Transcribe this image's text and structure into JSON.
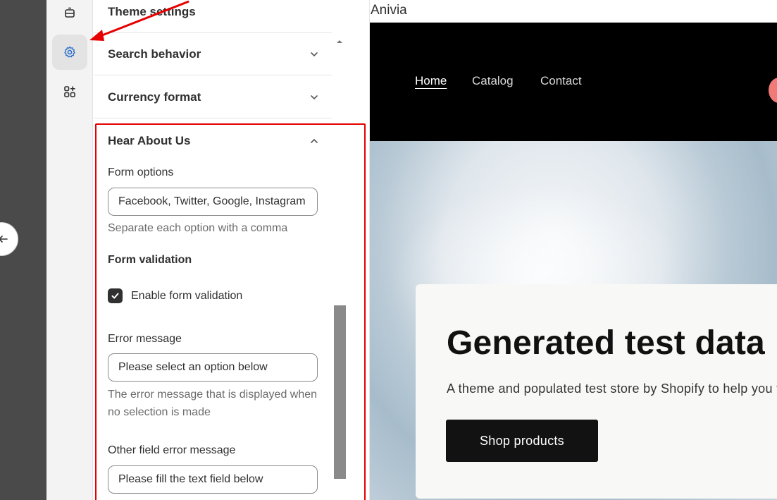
{
  "sidebar": {
    "sections": [
      {
        "title": "Theme settings"
      },
      {
        "title": "Search behavior"
      },
      {
        "title": "Currency format"
      }
    ],
    "hear_about_us": {
      "title": "Hear About Us",
      "form_options_label": "Form options",
      "form_options_value": "Facebook, Twitter, Google, Instagram",
      "form_options_help": "Separate each option with a comma",
      "form_validation_heading": "Form validation",
      "enable_validation_label": "Enable form validation",
      "enable_validation_checked": true,
      "error_message_label": "Error message",
      "error_message_value": "Please select an option below",
      "error_message_help": "The error message that is displayed when no selection is made",
      "other_error_label": "Other field error message",
      "other_error_value": "Please fill the text field below"
    }
  },
  "preview": {
    "store_name": "Anivia",
    "nav": [
      "Home",
      "Catalog",
      "Contact"
    ],
    "hero_title": "Generated test data",
    "hero_subtitle": "A theme and populated test store by Shopify to help you test commerce primitives.",
    "hero_button": "Shop products"
  },
  "colors": {
    "highlight": "#e60000",
    "header_bg": "#000000",
    "button_bg": "#121212",
    "accent_icon": "#2c6ecb"
  },
  "icons": {
    "rail": [
      "sections-icon",
      "gear-icon",
      "apps-icon"
    ],
    "chevron_collapsed": "chevron-down-icon",
    "chevron_expanded": "chevron-up-icon"
  }
}
